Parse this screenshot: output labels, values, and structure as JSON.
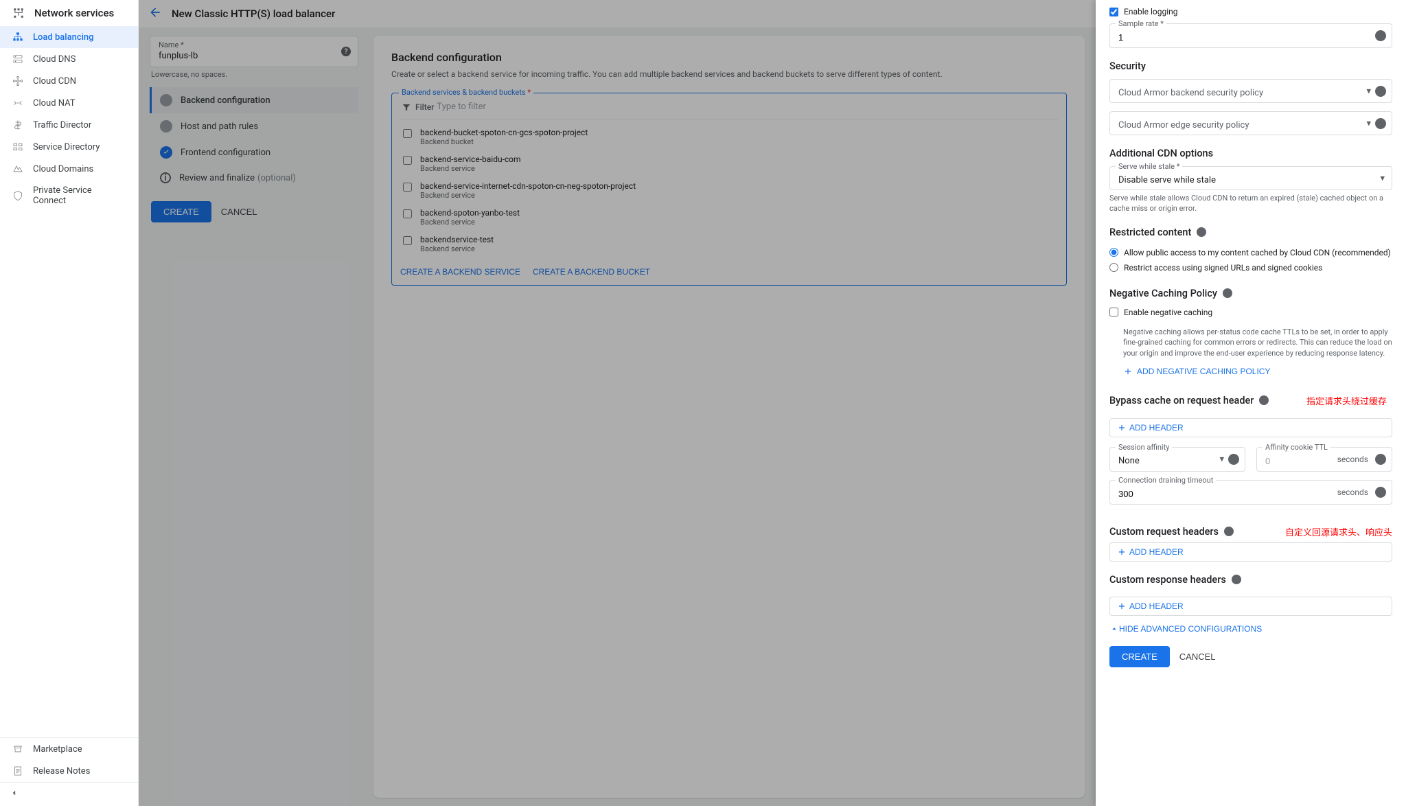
{
  "nav": {
    "title": "Network services",
    "items": [
      {
        "label": "Load balancing",
        "active": true
      },
      {
        "label": "Cloud DNS"
      },
      {
        "label": "Cloud CDN"
      },
      {
        "label": "Cloud NAT"
      },
      {
        "label": "Traffic Director"
      },
      {
        "label": "Service Directory"
      },
      {
        "label": "Cloud Domains"
      },
      {
        "label": "Private Service Connect"
      }
    ],
    "bottom": [
      {
        "label": "Marketplace"
      },
      {
        "label": "Release Notes"
      }
    ]
  },
  "header": {
    "title": "New Classic HTTP(S) load balancer"
  },
  "name_field": {
    "label": "Name *",
    "value": "funplus-lb",
    "hint": "Lowercase, no spaces."
  },
  "steps": {
    "backend": "Backend configuration",
    "host": "Host and path rules",
    "frontend": "Frontend configuration",
    "review": "Review and finalize",
    "optional": "(optional)"
  },
  "actions": {
    "create": "CREATE",
    "cancel": "CANCEL"
  },
  "config": {
    "title": "Backend configuration",
    "desc": "Create or select a backend service for incoming traffic. You can add multiple backend services and backend buckets to serve different types of content.",
    "fieldset_label": "Backend services & backend buckets",
    "req": "*",
    "filter_label": "Filter",
    "filter_placeholder": "Type to filter",
    "backends": [
      {
        "name": "backend-bucket-spoton-cn-gcs-spoton-project",
        "type": "Backend bucket"
      },
      {
        "name": "backend-service-baidu-com",
        "type": "Backend service"
      },
      {
        "name": "backend-service-internet-cdn-spoton-cn-neg-spoton-project",
        "type": "Backend service"
      },
      {
        "name": "backend-spoton-yanbo-test",
        "type": "Backend service"
      },
      {
        "name": "backendservice-test",
        "type": "Backend service"
      }
    ],
    "create_service": "CREATE A BACKEND SERVICE",
    "create_bucket": "CREATE A BACKEND BUCKET"
  },
  "panel": {
    "enable_logging": "Enable logging",
    "sample_rate_label": "Sample rate *",
    "sample_rate_value": "1",
    "security_title": "Security",
    "armor_backend": "Cloud Armor backend security policy",
    "armor_edge": "Cloud Armor edge security policy",
    "cdn_title": "Additional CDN options",
    "serve_stale_label": "Serve while stale *",
    "serve_stale_value": "Disable serve while stale",
    "serve_stale_help": "Serve while stale allows Cloud CDN to return an expired (stale) cached object on a cache miss or origin error.",
    "restricted_title": "Restricted content",
    "restricted_opt1": "Allow public access to my content cached by Cloud CDN (recommended)",
    "restricted_opt2": "Restrict access using signed URLs and signed cookies",
    "neg_title": "Negative Caching Policy",
    "neg_enable": "Enable negative caching",
    "neg_help": "Negative caching allows per-status code cache TTLs to be set, in order to apply fine-grained caching for common errors or redirects. This can reduce the load on your origin and improve the end-user experience by reducing response latency.",
    "neg_add": "ADD NEGATIVE CACHING POLICY",
    "bypass_title": "Bypass cache on request header",
    "add_header": "ADD HEADER",
    "session_affinity_label": "Session affinity",
    "session_affinity_value": "None",
    "cookie_ttl_label": "Affinity cookie TTL",
    "cookie_ttl_value": "0",
    "seconds": "seconds",
    "drain_label": "Connection draining timeout",
    "drain_value": "300",
    "custom_req_title": "Custom request headers",
    "custom_res_title": "Custom response headers",
    "hide_adv": "HIDE ADVANCED CONFIGURATIONS",
    "create": "CREATE",
    "cancel": "CANCEL"
  },
  "annotations": {
    "bypass": "指定请求头绕过缓存",
    "custom": "自定义回源请求头、响应头"
  }
}
